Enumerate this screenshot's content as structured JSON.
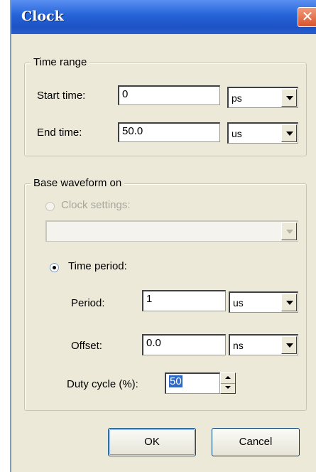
{
  "window": {
    "title": "Clock",
    "close_glyph": "✕"
  },
  "time_range": {
    "legend": "Time range",
    "start": {
      "label": "Start time:",
      "value": "0",
      "unit": "ps"
    },
    "end": {
      "label": "End time:",
      "value": "50.0",
      "unit": "us"
    }
  },
  "base_waveform": {
    "legend": "Base waveform on",
    "clock_settings": {
      "label": "Clock settings:",
      "checked": false,
      "enabled": false,
      "selected": ""
    },
    "time_period": {
      "label": "Time period:",
      "checked": true,
      "period": {
        "label": "Period:",
        "value": "1",
        "unit": "us"
      },
      "offset": {
        "label": "Offset:",
        "value": "0.0",
        "unit": "ns"
      },
      "duty_cycle": {
        "label": "Duty cycle (%):",
        "value": "50"
      }
    }
  },
  "buttons": {
    "ok": "OK",
    "cancel": "Cancel"
  }
}
